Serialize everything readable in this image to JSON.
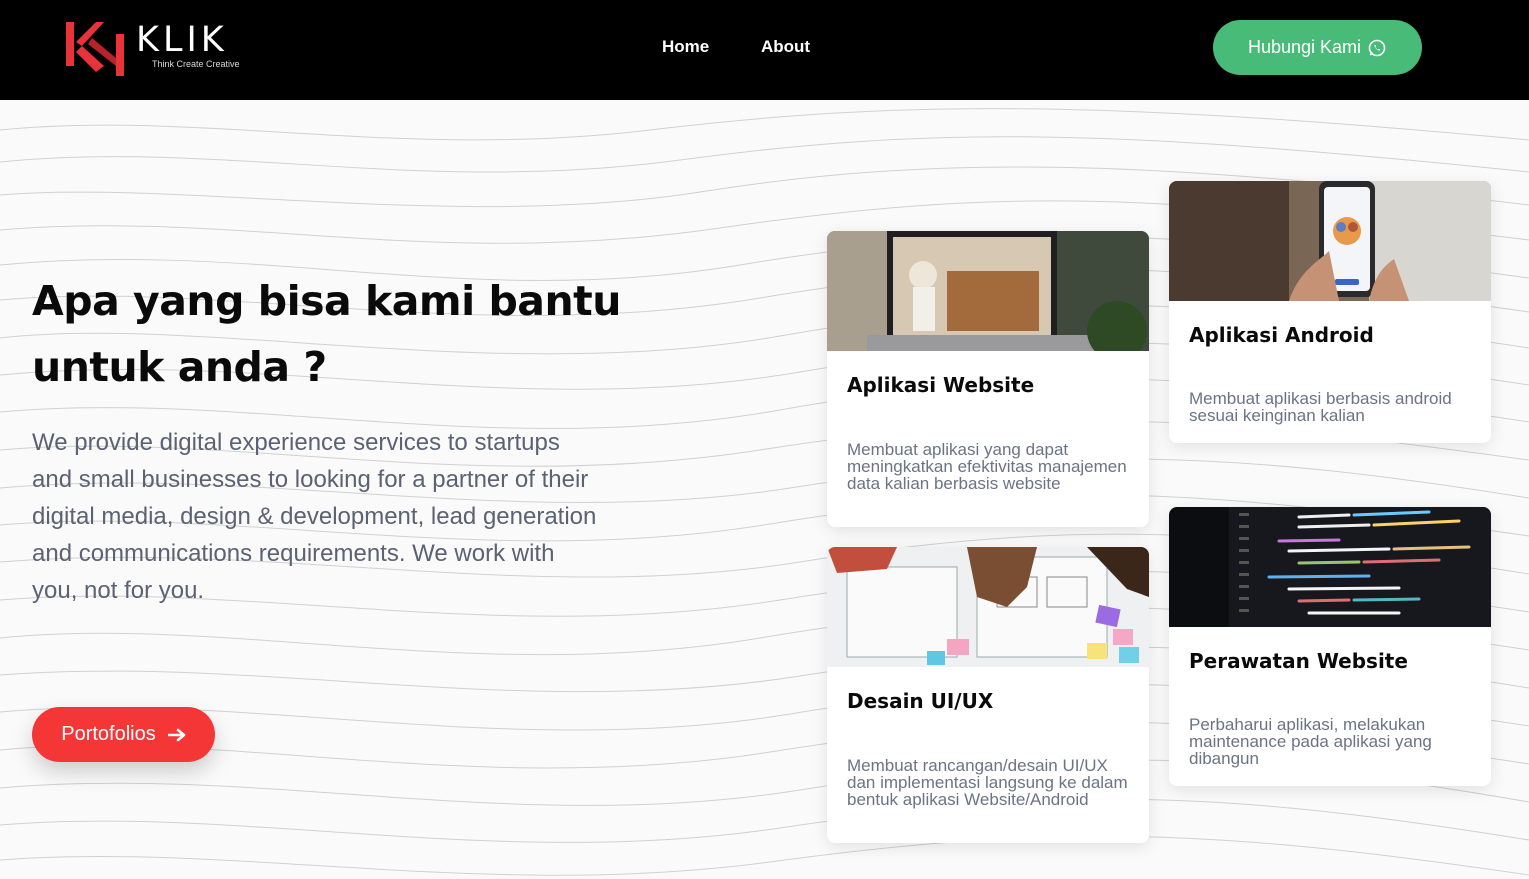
{
  "brand": {
    "name": "KLIK",
    "tagline": "Think Create Creative",
    "accent_color": "#f53636"
  },
  "nav": {
    "links": [
      {
        "label": "Home"
      },
      {
        "label": "About"
      }
    ],
    "contact_button": {
      "label": "Hubungi Kami",
      "icon": "whatsapp-icon",
      "color": "#48bb78"
    }
  },
  "hero": {
    "title": "Apa yang bisa kami bantu untuk anda ?",
    "description": "We provide digital experience services to startups and small businesses to looking for a partner of their digital media, design & development, lead generation and communications requirements. We work with you, not for you.",
    "cta": {
      "label": "Portofolios",
      "icon": "arrow-right-icon"
    }
  },
  "services": [
    {
      "title": "Aplikasi Website",
      "description": "Membuat aplikasi yang dapat meningkatkan efektivitas manajemen data kalian berbasis website",
      "image": "laptop-photo"
    },
    {
      "title": "Aplikasi Android",
      "description": "Membuat aplikasi berbasis android sesuai keinginan kalian",
      "image": "smartphone-photo"
    },
    {
      "title": "Desain UI/UX",
      "description": "Membuat rancangan/desain UI/UX dan implementasi langsung ke dalam bentuk aplikasi Website/Android",
      "image": "wireframe-photo"
    },
    {
      "title": "Perawatan Website",
      "description": "Perbaharui aplikasi, melakukan maintenance pada aplikasi yang dibangun",
      "image": "code-screen-photo"
    }
  ]
}
